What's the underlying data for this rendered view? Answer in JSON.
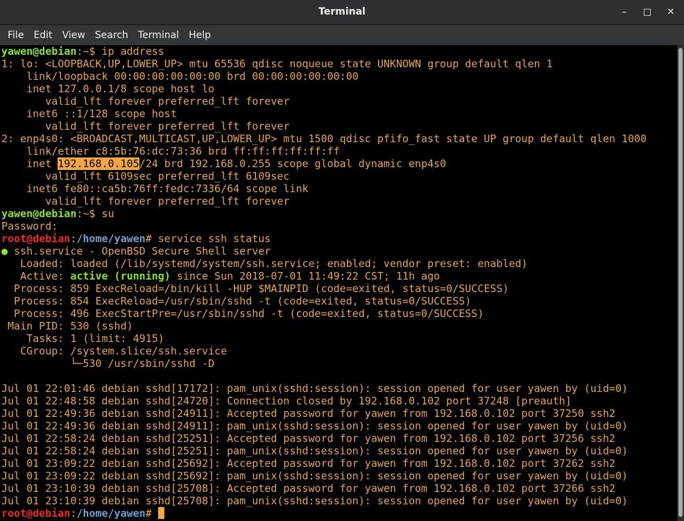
{
  "window": {
    "title": "Terminal",
    "minimize": "–",
    "maximize": "□",
    "close": "✕"
  },
  "menu": [
    "File",
    "Edit",
    "View",
    "Search",
    "Terminal",
    "Help"
  ],
  "colors": {
    "foreground": "#e5a553",
    "prompt_user": "#8ae234",
    "prompt_root": "#ef2929",
    "path": "#729fcf",
    "selection": "#f5a742"
  },
  "lines": [
    [
      {
        "t": "yawen@debian",
        "c": "green"
      },
      {
        "t": ":~$ ip address"
      }
    ],
    [
      {
        "t": "1: lo: <LOOPBACK,UP,LOWER_UP> mtu 65536 qdisc noqueue state UNKNOWN group default qlen 1"
      }
    ],
    [
      {
        "t": "    link/loopback 00:00:00:00:00:00 brd 00:00:00:00:00:00"
      }
    ],
    [
      {
        "t": "    inet 127.0.0.1/8 scope host lo"
      }
    ],
    [
      {
        "t": "       valid_lft forever preferred_lft forever"
      }
    ],
    [
      {
        "t": "    inet6 ::1/128 scope host"
      }
    ],
    [
      {
        "t": "       valid_lft forever preferred_lft forever"
      }
    ],
    [
      {
        "t": "2: enp4s0: <BROADCAST,MULTICAST,UP,LOWER_UP> mtu 1500 qdisc pfifo_fast state UP group default qlen 1000"
      }
    ],
    [
      {
        "t": "    link/ether c8:5b:76:dc:73:36 brd ff:ff:ff:ff:ff:ff"
      }
    ],
    [
      {
        "t": "    inet "
      },
      {
        "t": "192.168.0.105",
        "c": "sel"
      },
      {
        "t": "/24 brd 192.168.0.255 scope global dynamic enp4s0"
      }
    ],
    [
      {
        "t": "       valid_lft 6109sec preferred_lft 6109sec"
      }
    ],
    [
      {
        "t": "    inet6 fe80::ca5b:76ff:fedc:7336/64 scope link"
      }
    ],
    [
      {
        "t": "       valid_lft forever preferred_lft forever"
      }
    ],
    [
      {
        "t": "yawen@debian",
        "c": "green"
      },
      {
        "t": ":~$ su"
      }
    ],
    [
      {
        "t": "Password:"
      }
    ],
    [
      {
        "t": "root@debian",
        "c": "red"
      },
      {
        "t": ":"
      },
      {
        "t": "/home/yawen",
        "c": "blue"
      },
      {
        "t": "# service ssh status"
      }
    ],
    [
      {
        "t": "●",
        "c": "dot"
      },
      {
        "t": " ssh.service - OpenBSD Secure Shell server"
      }
    ],
    [
      {
        "t": "   Loaded: loaded (/lib/systemd/system/ssh.service; enabled; vendor preset: enabled)"
      }
    ],
    [
      {
        "t": "   Active: "
      },
      {
        "t": "active (running)",
        "c": "green"
      },
      {
        "t": " since Sun 2018-07-01 11:49:22 CST; 11h ago"
      }
    ],
    [
      {
        "t": "  Process: 859 ExecReload=/bin/kill -HUP $MAINPID (code=exited, status=0/SUCCESS)"
      }
    ],
    [
      {
        "t": "  Process: 854 ExecReload=/usr/sbin/sshd -t (code=exited, status=0/SUCCESS)"
      }
    ],
    [
      {
        "t": "  Process: 496 ExecStartPre=/usr/sbin/sshd -t (code=exited, status=0/SUCCESS)"
      }
    ],
    [
      {
        "t": " Main PID: 530 (sshd)"
      }
    ],
    [
      {
        "t": "    Tasks: 1 (limit: 4915)"
      }
    ],
    [
      {
        "t": "   CGroup: /system.slice/ssh.service"
      }
    ],
    [
      {
        "t": "           └─530 /usr/sbin/sshd -D"
      }
    ],
    [
      {
        "t": ""
      }
    ],
    [
      {
        "t": "Jul 01 22:01:46 debian sshd[17172]: pam_unix(sshd:session): session opened for user yawen by (uid=0)"
      }
    ],
    [
      {
        "t": "Jul 01 22:48:58 debian sshd[24720]: Connection closed by 192.168.0.102 port 37248 [preauth]"
      }
    ],
    [
      {
        "t": "Jul 01 22:49:36 debian sshd[24911]: Accepted password for yawen from 192.168.0.102 port 37250 ssh2"
      }
    ],
    [
      {
        "t": "Jul 01 22:49:36 debian sshd[24911]: pam_unix(sshd:session): session opened for user yawen by (uid=0)"
      }
    ],
    [
      {
        "t": "Jul 01 22:58:24 debian sshd[25251]: Accepted password for yawen from 192.168.0.102 port 37256 ssh2"
      }
    ],
    [
      {
        "t": "Jul 01 22:58:24 debian sshd[25251]: pam_unix(sshd:session): session opened for user yawen by (uid=0)"
      }
    ],
    [
      {
        "t": "Jul 01 23:09:22 debian sshd[25692]: Accepted password for yawen from 192.168.0.102 port 37262 ssh2"
      }
    ],
    [
      {
        "t": "Jul 01 23:09:22 debian sshd[25692]: pam_unix(sshd:session): session opened for user yawen by (uid=0)"
      }
    ],
    [
      {
        "t": "Jul 01 23:10:39 debian sshd[25708]: Accepted password for yawen from 192.168.0.102 port 37266 ssh2"
      }
    ],
    [
      {
        "t": "Jul 01 23:10:39 debian sshd[25708]: pam_unix(sshd:session): session opened for user yawen by (uid=0)"
      }
    ],
    [
      {
        "t": "root@debian",
        "c": "red"
      },
      {
        "t": ":"
      },
      {
        "t": "/home/yawen",
        "c": "blue"
      },
      {
        "t": "# "
      }
    ]
  ]
}
